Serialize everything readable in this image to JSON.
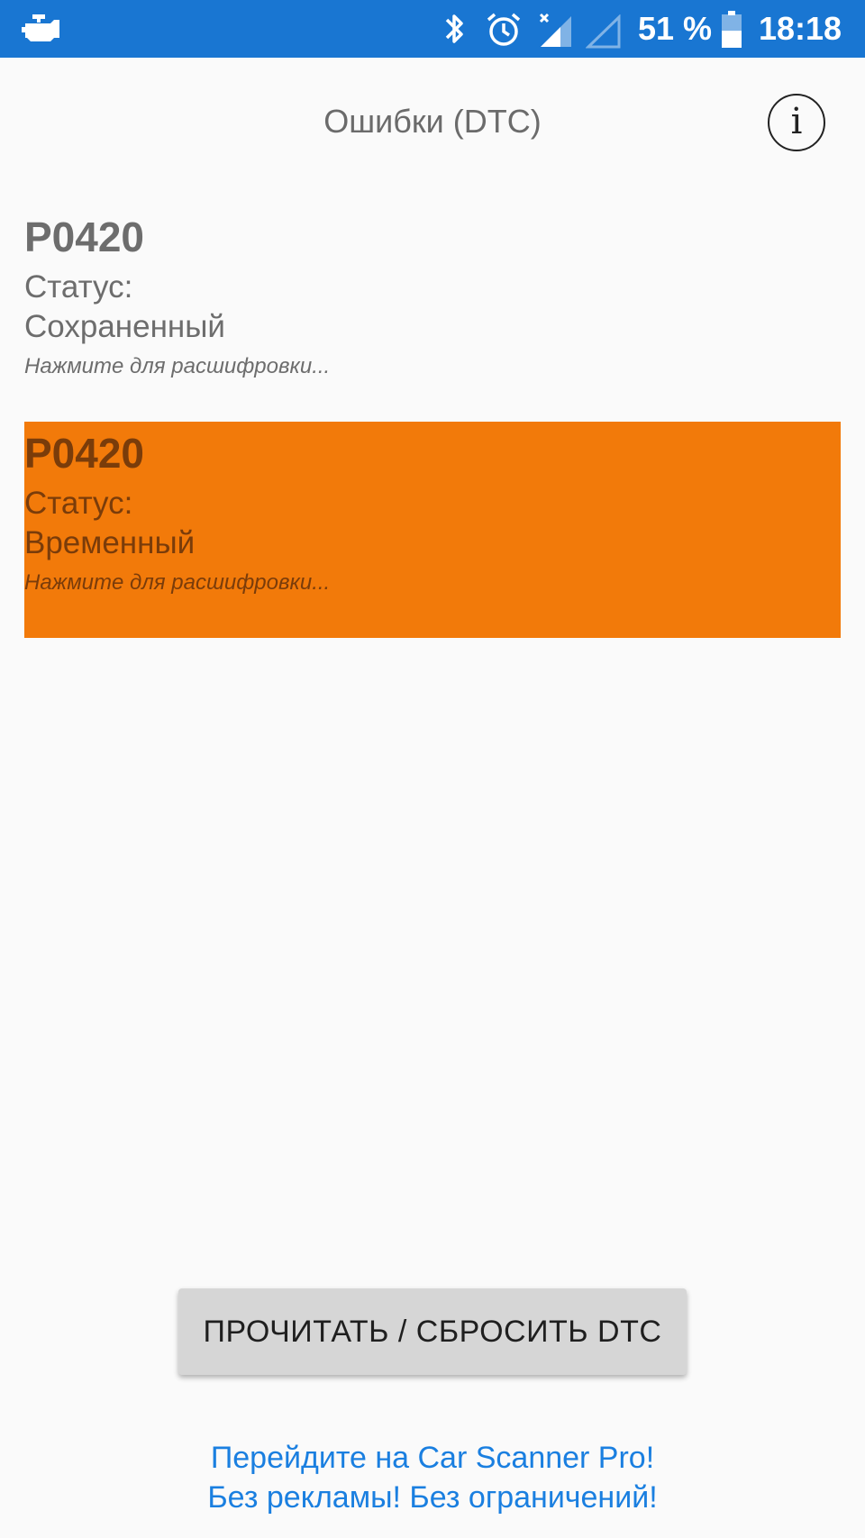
{
  "status_bar": {
    "battery_percent": "51 %",
    "battery_level": 0.51,
    "time": "18:18",
    "icons": [
      "engine-check-icon",
      "bluetooth-icon",
      "alarm-icon",
      "signal-icon",
      "signal-empty-icon",
      "battery-icon"
    ],
    "background_color": "#1976d2"
  },
  "header": {
    "title": "Ошибки (DTC)",
    "info_icon": "i"
  },
  "dtc_list": [
    {
      "code": "P0420",
      "status_label": "Статус:",
      "status_value": "Сохраненный",
      "hint": "Нажмите для расшифровки...",
      "highlight_color": null
    },
    {
      "code": "P0420",
      "status_label": "Статус:",
      "status_value": "Временный",
      "hint": "Нажмите для расшифровки...",
      "highlight_color": "#f27a0a"
    }
  ],
  "actions": {
    "read_reset_label": "ПРОЧИТАТЬ / СБРОСИТЬ DTC"
  },
  "promo": {
    "line1": "Перейдите на Car Scanner Pro!",
    "line2": "Без рекламы! Без ограничений!",
    "color": "#1a7fe0"
  }
}
